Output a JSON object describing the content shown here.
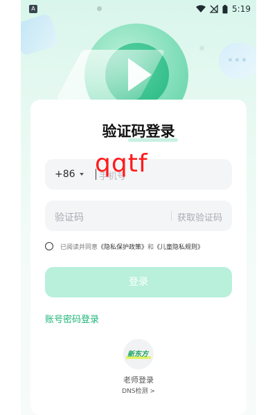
{
  "status_bar": {
    "left_badge": "A",
    "time": "5:19",
    "icons": [
      "wifi-icon",
      "signal-off-icon",
      "battery-icon"
    ]
  },
  "title": "验证码登录",
  "phone_field": {
    "country_code": "+86",
    "placeholder": "手机号",
    "overlay_text": "qqtf"
  },
  "code_field": {
    "placeholder": "验证码",
    "get_code": "获取验证码"
  },
  "agreement": {
    "prefix": "已阅读并同意",
    "privacy_link": "《隐私保护政策》",
    "and": "和",
    "child_link": "《儿童隐私规则》"
  },
  "login_button": "登录",
  "password_login": "账号密码登录",
  "teacher": {
    "logo_text": "新东方",
    "label": "老师登录",
    "dns": "DNS检测 >"
  },
  "colors": {
    "accent": "#1fb579",
    "button_bg": "#b8f0dc",
    "overlay_red": "#ff1b1b"
  }
}
